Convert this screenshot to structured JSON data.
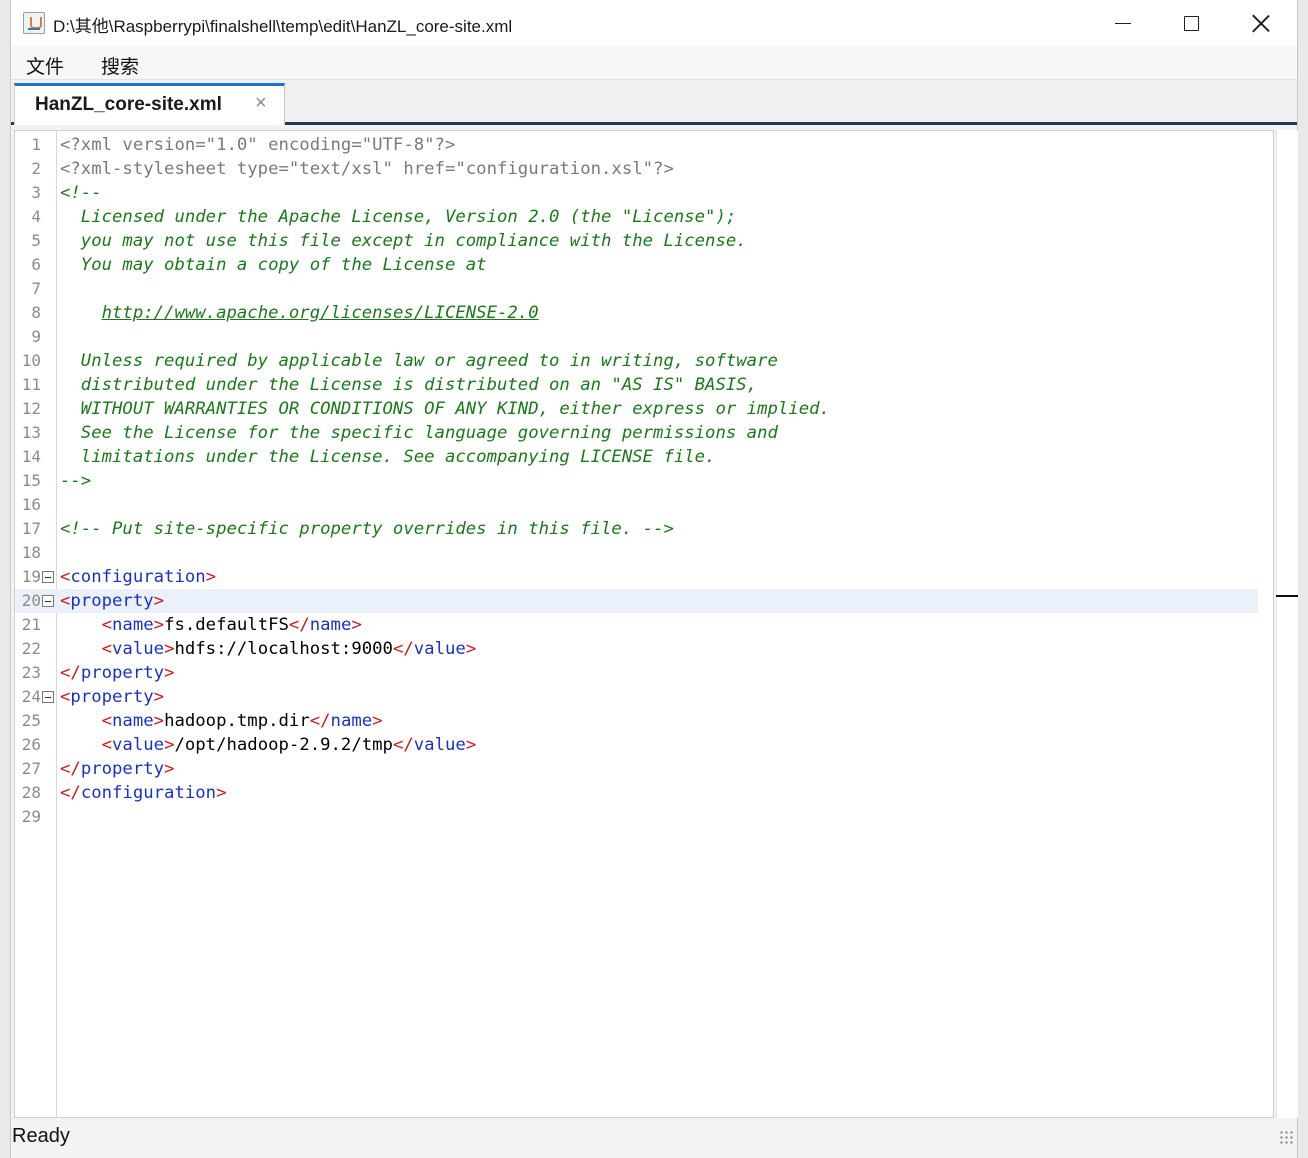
{
  "window": {
    "title": "D:\\其他\\Raspberrypi\\finalshell\\temp\\edit\\HanZL_core-site.xml",
    "icon": "java-cup-icon"
  },
  "menu": {
    "file_label": "文件",
    "search_label": "搜索"
  },
  "tab": {
    "label": "HanZL_core-site.xml",
    "close_glyph": "×"
  },
  "status": {
    "text": "Ready"
  },
  "editor": {
    "current_line": 20,
    "lines": [
      {
        "n": "1",
        "fold": false,
        "tokens": [
          {
            "t": "prolog",
            "v": "<?xml version=\"1.0\" encoding=\"UTF-8\"?>"
          }
        ]
      },
      {
        "n": "2",
        "fold": false,
        "tokens": [
          {
            "t": "prolog",
            "v": "<?xml-stylesheet type=\"text/xsl\" href=\"configuration.xsl\"?>"
          }
        ]
      },
      {
        "n": "3",
        "fold": false,
        "tokens": [
          {
            "t": "comment",
            "v": "<!--"
          }
        ]
      },
      {
        "n": "4",
        "fold": false,
        "tokens": [
          {
            "t": "comment",
            "v": "  Licensed under the Apache License, Version 2.0 (the \"License\");"
          }
        ]
      },
      {
        "n": "5",
        "fold": false,
        "tokens": [
          {
            "t": "comment",
            "v": "  you may not use this file except in compliance with the License."
          }
        ]
      },
      {
        "n": "6",
        "fold": false,
        "tokens": [
          {
            "t": "comment",
            "v": "  You may obtain a copy of the License at"
          }
        ]
      },
      {
        "n": "7",
        "fold": false,
        "tokens": []
      },
      {
        "n": "8",
        "fold": false,
        "tokens": [
          {
            "t": "comment",
            "v": "    "
          },
          {
            "t": "link",
            "v": "http://www.apache.org/licenses/LICENSE-2.0"
          }
        ]
      },
      {
        "n": "9",
        "fold": false,
        "tokens": []
      },
      {
        "n": "10",
        "fold": false,
        "tokens": [
          {
            "t": "comment",
            "v": "  Unless required by applicable law or agreed to in writing, software"
          }
        ]
      },
      {
        "n": "11",
        "fold": false,
        "tokens": [
          {
            "t": "comment",
            "v": "  distributed under the License is distributed on an \"AS IS\" BASIS,"
          }
        ]
      },
      {
        "n": "12",
        "fold": false,
        "tokens": [
          {
            "t": "comment",
            "v": "  WITHOUT WARRANTIES OR CONDITIONS OF ANY KIND, either express or implied."
          }
        ]
      },
      {
        "n": "13",
        "fold": false,
        "tokens": [
          {
            "t": "comment",
            "v": "  See the License for the specific language governing permissions and"
          }
        ]
      },
      {
        "n": "14",
        "fold": false,
        "tokens": [
          {
            "t": "comment",
            "v": "  limitations under the License. See accompanying LICENSE file."
          }
        ]
      },
      {
        "n": "15",
        "fold": false,
        "tokens": [
          {
            "t": "comment",
            "v": "-->"
          }
        ]
      },
      {
        "n": "16",
        "fold": false,
        "tokens": []
      },
      {
        "n": "17",
        "fold": false,
        "tokens": [
          {
            "t": "comment",
            "v": "<!-- Put site-specific property overrides in this file. -->"
          }
        ]
      },
      {
        "n": "18",
        "fold": false,
        "tokens": []
      },
      {
        "n": "19",
        "fold": true,
        "tokens": [
          {
            "t": "bracket",
            "v": "<"
          },
          {
            "t": "tag",
            "v": "configuration"
          },
          {
            "t": "bracket",
            "v": ">"
          }
        ]
      },
      {
        "n": "20",
        "fold": true,
        "tokens": [
          {
            "t": "bracket",
            "v": "<"
          },
          {
            "t": "tag",
            "v": "property"
          },
          {
            "t": "bracket",
            "v": ">"
          }
        ]
      },
      {
        "n": "21",
        "fold": false,
        "tokens": [
          {
            "t": "text",
            "v": "    "
          },
          {
            "t": "bracket",
            "v": "<"
          },
          {
            "t": "tag",
            "v": "name"
          },
          {
            "t": "bracket",
            "v": ">"
          },
          {
            "t": "text",
            "v": "fs.defaultFS"
          },
          {
            "t": "bracket",
            "v": "</"
          },
          {
            "t": "tag",
            "v": "name"
          },
          {
            "t": "bracket",
            "v": ">"
          }
        ]
      },
      {
        "n": "22",
        "fold": false,
        "tokens": [
          {
            "t": "text",
            "v": "    "
          },
          {
            "t": "bracket",
            "v": "<"
          },
          {
            "t": "tag",
            "v": "value"
          },
          {
            "t": "bracket",
            "v": ">"
          },
          {
            "t": "text",
            "v": "hdfs://localhost:9000"
          },
          {
            "t": "bracket",
            "v": "</"
          },
          {
            "t": "tag",
            "v": "value"
          },
          {
            "t": "bracket",
            "v": ">"
          }
        ]
      },
      {
        "n": "23",
        "fold": false,
        "tokens": [
          {
            "t": "bracket",
            "v": "</"
          },
          {
            "t": "tag",
            "v": "property"
          },
          {
            "t": "bracket",
            "v": ">"
          }
        ]
      },
      {
        "n": "24",
        "fold": true,
        "tokens": [
          {
            "t": "bracket",
            "v": "<"
          },
          {
            "t": "tag",
            "v": "property"
          },
          {
            "t": "bracket",
            "v": ">"
          }
        ]
      },
      {
        "n": "25",
        "fold": false,
        "tokens": [
          {
            "t": "text",
            "v": "    "
          },
          {
            "t": "bracket",
            "v": "<"
          },
          {
            "t": "tag",
            "v": "name"
          },
          {
            "t": "bracket",
            "v": ">"
          },
          {
            "t": "text",
            "v": "hadoop.tmp.dir"
          },
          {
            "t": "bracket",
            "v": "</"
          },
          {
            "t": "tag",
            "v": "name"
          },
          {
            "t": "bracket",
            "v": ">"
          }
        ]
      },
      {
        "n": "26",
        "fold": false,
        "tokens": [
          {
            "t": "text",
            "v": "    "
          },
          {
            "t": "bracket",
            "v": "<"
          },
          {
            "t": "tag",
            "v": "value"
          },
          {
            "t": "bracket",
            "v": ">"
          },
          {
            "t": "text",
            "v": "/opt/hadoop-2.9.2/tmp"
          },
          {
            "t": "bracket",
            "v": "</"
          },
          {
            "t": "tag",
            "v": "value"
          },
          {
            "t": "bracket",
            "v": ">"
          }
        ]
      },
      {
        "n": "27",
        "fold": false,
        "tokens": [
          {
            "t": "bracket",
            "v": "</"
          },
          {
            "t": "tag",
            "v": "property"
          },
          {
            "t": "bracket",
            "v": ">"
          }
        ]
      },
      {
        "n": "28",
        "fold": false,
        "tokens": [
          {
            "t": "bracket",
            "v": "</"
          },
          {
            "t": "tag",
            "v": "configuration"
          },
          {
            "t": "bracket",
            "v": ">"
          }
        ]
      },
      {
        "n": "29",
        "fold": false,
        "tokens": []
      }
    ]
  }
}
